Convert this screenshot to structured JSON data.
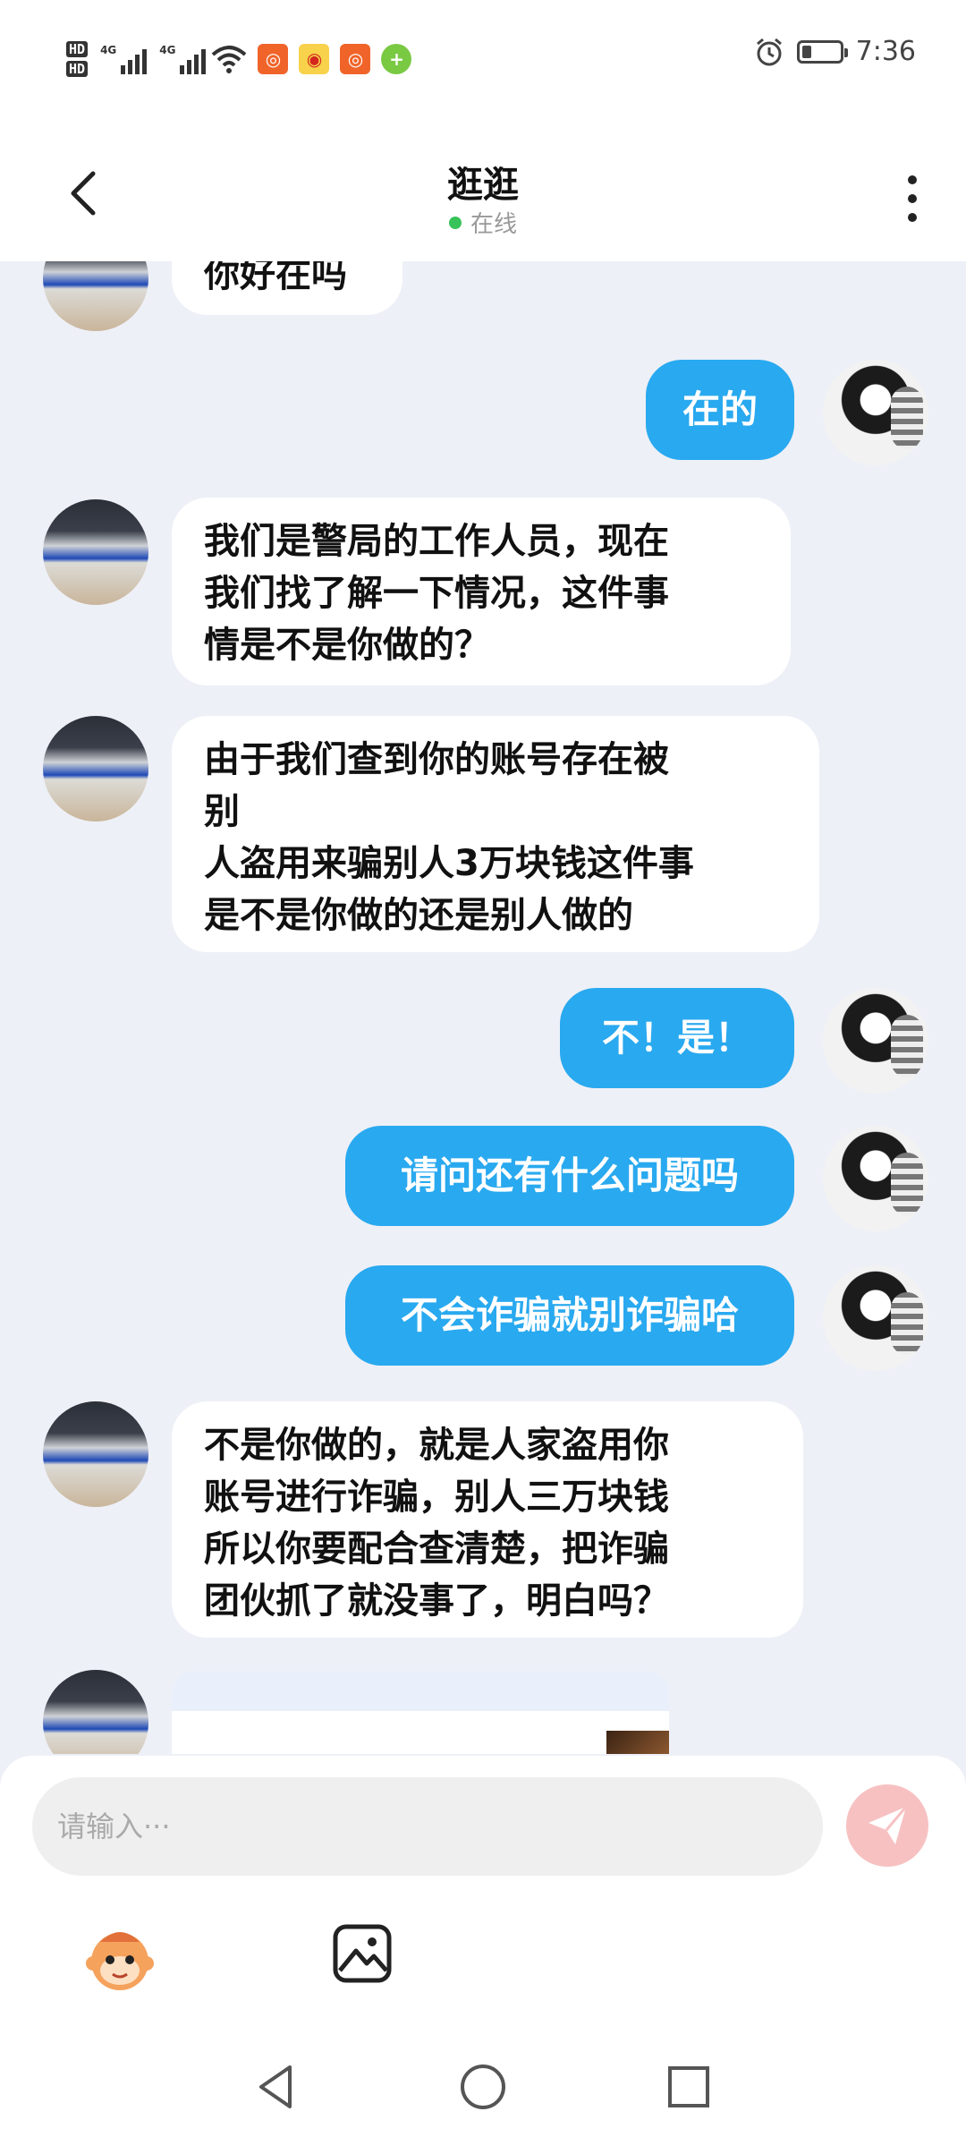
{
  "status_bar": {
    "hd1": "HD",
    "hd2": "HD",
    "net1": "4G",
    "net2": "4G",
    "time": "7:36",
    "icons": [
      "signal-icon",
      "wifi-icon",
      "kuaishou-icon",
      "weibo-icon",
      "kuaishou-icon",
      "app-icon",
      "alarm-icon",
      "battery-icon"
    ]
  },
  "header": {
    "title": "逛逛",
    "status": "在线"
  },
  "messages": [
    {
      "side": "in",
      "text": "你好在吗"
    },
    {
      "side": "out",
      "text": "在的"
    },
    {
      "side": "in",
      "text": "我们是警局的工作人员，现在\n我们找了解一下情况，这件事\n情是不是你做的？"
    },
    {
      "side": "in",
      "text": "由于我们查到你的账号存在被\n别\n人盗用来骗别人3万块钱这件事\n是不是你做的还是别人做的"
    },
    {
      "side": "out",
      "text": "不！是！"
    },
    {
      "side": "out",
      "text": "请问还有什么问题吗"
    },
    {
      "side": "out",
      "text": "不会诈骗就别诈骗哈"
    },
    {
      "side": "in",
      "text": "不是你做的，就是人家盗用你\n账号进行诈骗，别人三万块钱\n所以你要配合查清楚，把诈骗\n团伙抓了就没事了，明白吗？"
    }
  ],
  "input": {
    "placeholder": "请输入···"
  },
  "colors": {
    "outgoing_bubble": "#29a9ef",
    "incoming_bubble": "#ffffff",
    "chat_background": "#eef0f7",
    "send_button": "#f7c1c2",
    "online_dot": "#38c35a"
  },
  "toolbar_icons": [
    "emoji-icon",
    "image-icon"
  ],
  "nav_icons": [
    "back-triangle-icon",
    "home-circle-icon",
    "recents-square-icon"
  ]
}
